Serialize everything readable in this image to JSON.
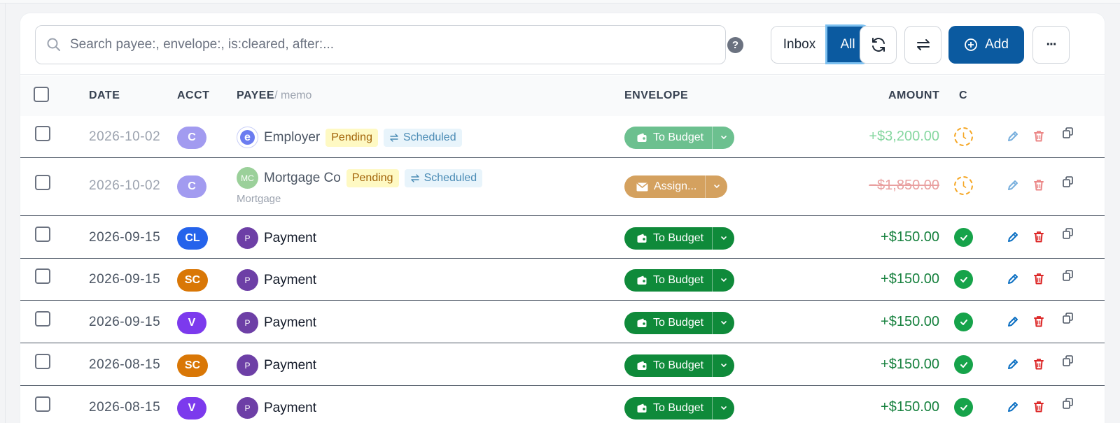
{
  "search": {
    "placeholder": "Search payee:, envelope:, is:cleared, after:..."
  },
  "toolbar": {
    "help_label": "?",
    "filter_inbox": "Inbox",
    "filter_all": "All",
    "add_label": "Add",
    "more_label": "···"
  },
  "columns": {
    "date": "DATE",
    "acct": "ACCT",
    "payee": "PAYEE",
    "memo": "/ memo",
    "envelope": "ENVELOPE",
    "amount": "AMOUNT",
    "cleared": "C"
  },
  "rows": [
    {
      "date": "2026-10-02",
      "acct": "C",
      "acct_color": "#a29bf0",
      "payee": "Employer",
      "avatar": "e",
      "avatar_color": "#7c8cf0",
      "pending": "Pending",
      "scheduled": "Scheduled",
      "memo": "",
      "envelope": "To Budget",
      "env_color": "#6cc08f",
      "amount": "+$3,200.00",
      "amount_color": "#86d7a0",
      "cleared": false
    },
    {
      "date": "2026-10-02",
      "acct": "C",
      "acct_color": "#a29bf0",
      "payee": "Mortgage Co",
      "avatar": "MC",
      "avatar_color": "#9bd09a",
      "pending": "Pending",
      "scheduled": "Scheduled",
      "memo": "Mortgage",
      "envelope": "Assign...",
      "env_color": "#d4a15f",
      "amount": "−$1,850.00",
      "amount_color": "#e9a0a0",
      "cleared": false
    },
    {
      "date": "2026-09-15",
      "acct": "CL",
      "acct_color": "#2563eb",
      "payee": "Payment",
      "avatar": "P",
      "avatar_color": "#6d3fa6",
      "pending": "",
      "scheduled": "",
      "memo": "",
      "envelope": "To Budget",
      "env_color": "#0f8a3a",
      "amount": "+$150.00",
      "amount_color": "#15803d",
      "cleared": true
    },
    {
      "date": "2026-09-15",
      "acct": "SC",
      "acct_color": "#d97706",
      "payee": "Payment",
      "avatar": "P",
      "avatar_color": "#6d3fa6",
      "pending": "",
      "scheduled": "",
      "memo": "",
      "envelope": "To Budget",
      "env_color": "#0f8a3a",
      "amount": "+$150.00",
      "amount_color": "#15803d",
      "cleared": true
    },
    {
      "date": "2026-09-15",
      "acct": "V",
      "acct_color": "#7c3aed",
      "payee": "Payment",
      "avatar": "P",
      "avatar_color": "#6d3fa6",
      "pending": "",
      "scheduled": "",
      "memo": "",
      "envelope": "To Budget",
      "env_color": "#0f8a3a",
      "amount": "+$150.00",
      "amount_color": "#15803d",
      "cleared": true
    },
    {
      "date": "2026-08-15",
      "acct": "SC",
      "acct_color": "#d97706",
      "payee": "Payment",
      "avatar": "P",
      "avatar_color": "#6d3fa6",
      "pending": "",
      "scheduled": "",
      "memo": "",
      "envelope": "To Budget",
      "env_color": "#0f8a3a",
      "amount": "+$150.00",
      "amount_color": "#15803d",
      "cleared": true
    },
    {
      "date": "2026-08-15",
      "acct": "V",
      "acct_color": "#7c3aed",
      "payee": "Payment",
      "avatar": "P",
      "avatar_color": "#6d3fa6",
      "pending": "",
      "scheduled": "",
      "memo": "",
      "envelope": "To Budget",
      "env_color": "#0f8a3a",
      "amount": "+$150.00",
      "amount_color": "#15803d",
      "cleared": true
    }
  ]
}
